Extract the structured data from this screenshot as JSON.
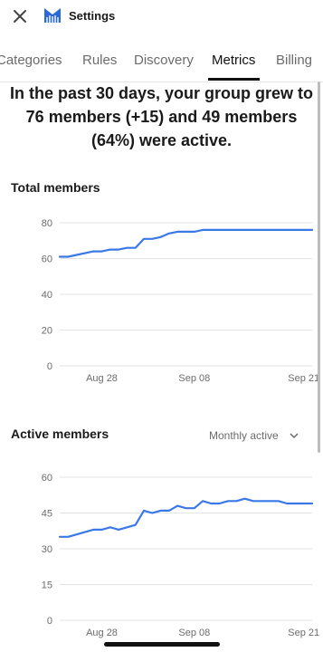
{
  "app": {
    "title": "Settings",
    "logo_icon": "members-logo-icon",
    "close_icon": "close-icon"
  },
  "tabs": [
    {
      "label": "Categories"
    },
    {
      "label": "Rules"
    },
    {
      "label": "Discovery"
    },
    {
      "label": "Metrics",
      "active": true
    },
    {
      "label": "Billing"
    }
  ],
  "summary": {
    "line1": "In the past 30 days, your group grew to",
    "line2": "76 members (+15) and 49 members",
    "line3": "(64%) were active."
  },
  "sections": {
    "total_members": {
      "title": "Total members"
    },
    "active_members": {
      "title": "Active members",
      "filter_label": "Monthly active",
      "filter_icon": "chevron-down-icon"
    }
  },
  "colors": {
    "line": "#3b78e7",
    "grid": "#e3e3e3",
    "accent_logo": "#2a6ad8"
  },
  "chart_data": [
    {
      "type": "line",
      "title": "Total members",
      "ylim": [
        0,
        80
      ],
      "yticks": [
        0,
        20,
        40,
        60,
        80
      ],
      "xticks": [
        {
          "label": "Aug 28",
          "day": 5
        },
        {
          "label": "Sep 08",
          "day": 16
        },
        {
          "label": "Sep 21",
          "day": 29
        }
      ],
      "grid": true,
      "x": [
        0,
        1,
        2,
        3,
        4,
        5,
        6,
        7,
        8,
        9,
        10,
        11,
        12,
        13,
        14,
        15,
        16,
        17,
        18,
        19,
        20,
        21,
        22,
        23,
        24,
        25,
        26,
        27,
        28,
        29,
        30
      ],
      "values": [
        61,
        61,
        62,
        63,
        64,
        64,
        65,
        65,
        66,
        66,
        71,
        71,
        72,
        74,
        75,
        75,
        75,
        76,
        76,
        76,
        76,
        76,
        76,
        76,
        76,
        76,
        76,
        76,
        76,
        76,
        76
      ]
    },
    {
      "type": "line",
      "title": "Active members",
      "ylim": [
        0,
        60
      ],
      "yticks": [
        0,
        15,
        30,
        45,
        60
      ],
      "xticks": [
        {
          "label": "Aug 28",
          "day": 5
        },
        {
          "label": "Sep 08",
          "day": 16
        },
        {
          "label": "Sep 21",
          "day": 29
        }
      ],
      "grid": true,
      "x": [
        0,
        1,
        2,
        3,
        4,
        5,
        6,
        7,
        8,
        9,
        10,
        11,
        12,
        13,
        14,
        15,
        16,
        17,
        18,
        19,
        20,
        21,
        22,
        23,
        24,
        25,
        26,
        27,
        28,
        29,
        30
      ],
      "values": [
        35,
        35,
        36,
        37,
        38,
        38,
        39,
        38,
        39,
        40,
        46,
        45,
        46,
        46,
        48,
        47,
        47,
        50,
        49,
        49,
        50,
        50,
        51,
        50,
        50,
        50,
        50,
        49,
        49,
        49,
        49
      ]
    }
  ]
}
